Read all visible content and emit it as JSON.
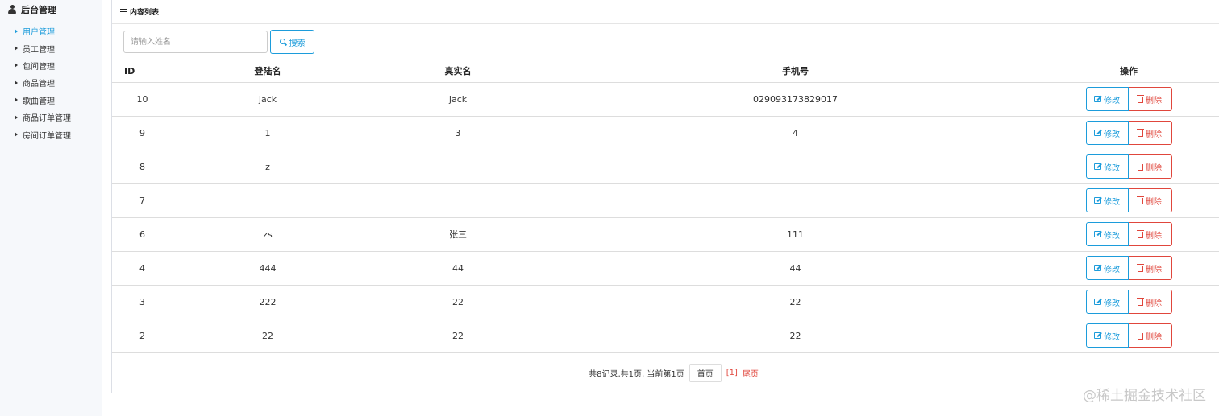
{
  "sidebar": {
    "title": "后台管理",
    "items": [
      {
        "label": "用户管理",
        "active": true
      },
      {
        "label": "员工管理"
      },
      {
        "label": "包间管理"
      },
      {
        "label": "商品管理"
      },
      {
        "label": "歌曲管理"
      },
      {
        "label": "商品订单管理"
      },
      {
        "label": "房间订单管理"
      }
    ]
  },
  "panel": {
    "heading": "内容列表",
    "search": {
      "placeholder": "请输入姓名",
      "value": "",
      "button_label": "搜索"
    },
    "table": {
      "headers": [
        "ID",
        "登陆名",
        "真实名",
        "手机号",
        "操作"
      ],
      "rows": [
        [
          "10",
          "jack",
          "jack",
          "029093173829017"
        ],
        [
          "9",
          "1",
          "3",
          "4"
        ],
        [
          "8",
          "z",
          "",
          ""
        ],
        [
          "7",
          "",
          "",
          ""
        ],
        [
          "6",
          "zs",
          "张三",
          "111"
        ],
        [
          "4",
          "444",
          "44",
          "44"
        ],
        [
          "3",
          "222",
          "22",
          "22"
        ],
        [
          "2",
          "22",
          "22",
          "22"
        ]
      ],
      "edit_label": "修改",
      "delete_label": "删除"
    },
    "pagination": {
      "summary": "共8记录,共1页, 当前第1页",
      "first_label": "首页",
      "current_label": "[1]",
      "last_label": "尾页"
    }
  },
  "watermark": "@稀土掘金技术社区",
  "colors": {
    "primary": "#1c9cdb",
    "danger": "#e0463c"
  },
  "icons": {
    "user": "user-icon",
    "list": "list-icon",
    "search": "search-icon",
    "edit": "edit-icon",
    "delete": "trash-icon"
  }
}
